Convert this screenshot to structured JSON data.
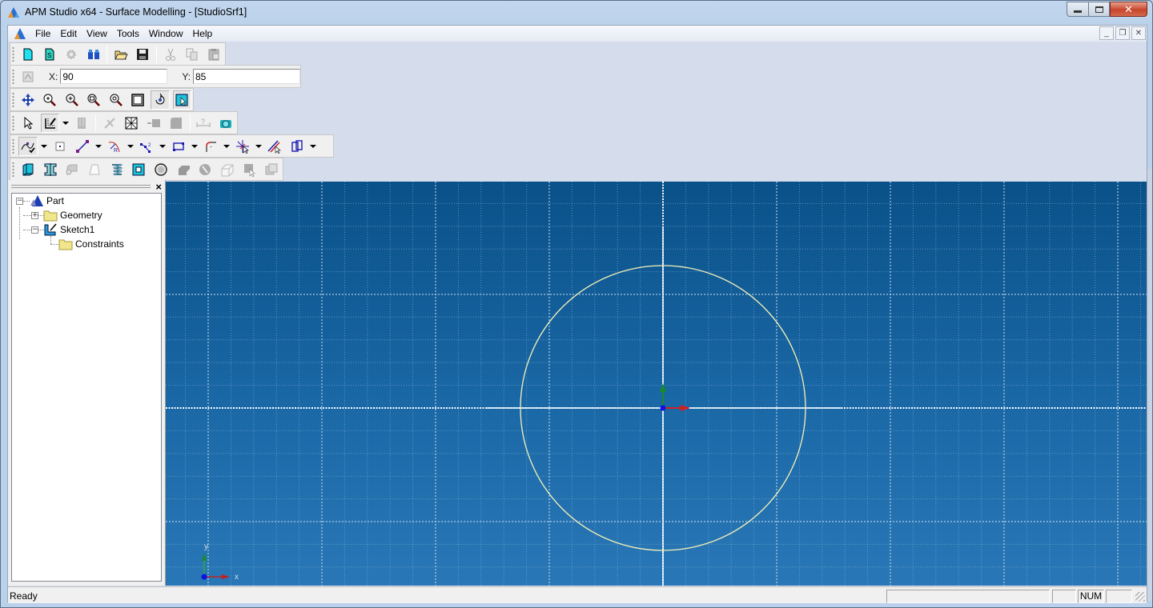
{
  "window": {
    "title": "APM Studio x64 - Surface Modelling - [StudioSrf1]",
    "app_icon": "apm-logo-icon",
    "caption_buttons": [
      {
        "name": "minimize",
        "glyph": "▁"
      },
      {
        "name": "maximize",
        "glyph": "▭"
      },
      {
        "name": "close",
        "glyph": "✕"
      }
    ]
  },
  "menubar": {
    "items": [
      "File",
      "Edit",
      "View",
      "Tools",
      "Window",
      "Help"
    ],
    "mdi_buttons": [
      {
        "name": "minimize",
        "glyph": "_"
      },
      {
        "name": "restore",
        "glyph": "❐"
      },
      {
        "name": "close",
        "glyph": "✕"
      }
    ]
  },
  "toolbars": {
    "standard": [
      "new-document",
      "new-sketch",
      "settings-gray",
      "find-binoculars",
      "open-folder",
      "save-disk",
      "cut",
      "copy",
      "paste"
    ],
    "coordinates": {
      "icon": "coordinates-icon",
      "x_label": "X:",
      "x_value": "90",
      "y_label": "Y:",
      "y_value": "85"
    },
    "view": [
      "pan",
      "zoom-in-out",
      "zoom-in",
      "zoom-window",
      "zoom-previous",
      "fit-all",
      "rotate",
      "select-view"
    ],
    "sketch": [
      "select-pointer",
      "sketch-mode",
      "table",
      "constraint-disabled",
      "hatch",
      "extrude-disabled",
      "solid-disabled",
      "dimension",
      "camera-view"
    ],
    "draw": [
      "spline",
      "point",
      "line",
      "arc-radius",
      "polyline",
      "rectangle",
      "fillet",
      "trim",
      "offset-line",
      "mirror"
    ],
    "features": [
      "extrude-surface",
      "revolve-surface",
      "loft-disabled",
      "shell-disabled",
      "spiral",
      "hole-square",
      "circle-ring",
      "fillet-disabled",
      "shell-round-disabled",
      "box-disabled",
      "select-disabled",
      "pattern-disabled"
    ]
  },
  "tree": {
    "close_glyph": "×",
    "items": [
      {
        "label": "Part",
        "toggle": "−",
        "icon": "part-icon"
      },
      {
        "label": "Geometry",
        "toggle": "+",
        "icon": "folder-icon"
      },
      {
        "label": "Sketch1",
        "toggle": "−",
        "icon": "sketch-icon"
      },
      {
        "label": "Constraints",
        "toggle": null,
        "icon": "folder-icon"
      }
    ]
  },
  "viewport": {
    "triad": {
      "x_label": "x",
      "y_label": "y"
    },
    "colors": {
      "background_top": "#0a5189",
      "background_bottom": "#2977b6",
      "circle": "#f4f1b8",
      "grid": "#8bb6dc",
      "axis_x": "#d42020",
      "axis_y": "#1a8a2a",
      "origin": "#1010e0"
    }
  },
  "statusbar": {
    "text": "Ready",
    "panes": [
      "",
      "",
      "NUM",
      ""
    ]
  }
}
